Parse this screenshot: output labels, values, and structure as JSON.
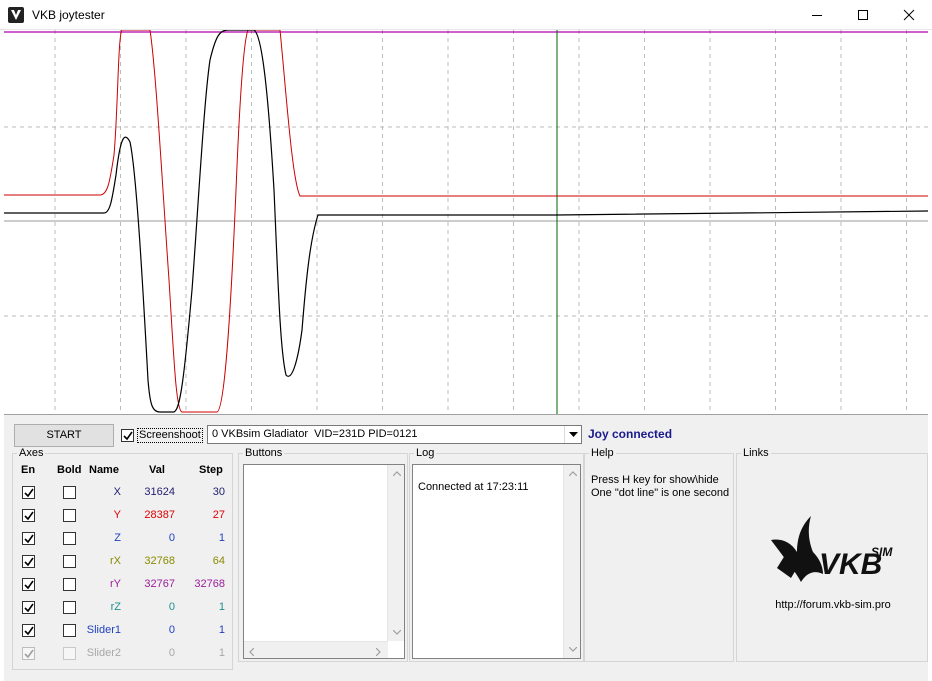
{
  "window": {
    "title": "VKB joytester",
    "controls": [
      "minimize-icon",
      "maximize-icon",
      "close-icon"
    ]
  },
  "plot": {
    "colors": {
      "x_trace": "#000000",
      "y_trace": "#cc0000",
      "top_line": "#b000b0",
      "cursor": "#006600",
      "grid": "#bbbbbb",
      "center": "#999999"
    }
  },
  "toolbar": {
    "start_label": "START",
    "screenshot_label": "Screenshoot",
    "screenshot_checked": true,
    "device_value": "0 VKBsim Gladiator  VID=231D PID=0121",
    "status": "Joy connected"
  },
  "axes": {
    "group_label": "Axes",
    "headers": {
      "en": "En",
      "bold": "Bold",
      "name": "Name",
      "val": "Val",
      "step": "Step"
    },
    "rows": [
      {
        "name": "X",
        "val": "31624",
        "step": "30",
        "color": "#1f1f70",
        "en": true,
        "bold": false,
        "disabled": false
      },
      {
        "name": "Y",
        "val": "28387",
        "step": "27",
        "color": "#e00000",
        "en": true,
        "bold": false,
        "disabled": false
      },
      {
        "name": "Z",
        "val": "0",
        "step": "1",
        "color": "#1f3fbf",
        "en": true,
        "bold": false,
        "disabled": false
      },
      {
        "name": "rX",
        "val": "32768",
        "step": "64",
        "color": "#8a8a00",
        "en": true,
        "bold": false,
        "disabled": false
      },
      {
        "name": "rY",
        "val": "32767",
        "step": "32768",
        "color": "#9a1f9a",
        "en": true,
        "bold": false,
        "disabled": false
      },
      {
        "name": "rZ",
        "val": "0",
        "step": "1",
        "color": "#1f8f8f",
        "en": true,
        "bold": false,
        "disabled": false
      },
      {
        "name": "Slider1",
        "val": "0",
        "step": "1",
        "color": "#1f3fbf",
        "en": true,
        "bold": false,
        "disabled": false
      },
      {
        "name": "Slider2",
        "val": "0",
        "step": "1",
        "color": "#a8a8a8",
        "en": true,
        "bold": false,
        "disabled": true
      }
    ]
  },
  "buttons_panel": {
    "label": "Buttons"
  },
  "log_panel": {
    "label": "Log",
    "entries": [
      "Connected at 17:23:11"
    ]
  },
  "help_panel": {
    "label": "Help",
    "lines": [
      "Press H key for show\\hide",
      "One \"dot line\" is one second"
    ]
  },
  "links_panel": {
    "label": "Links",
    "url": "http://forum.vkb-sim.pro",
    "logo_text": "VKB",
    "logo_sub": "SIM"
  }
}
